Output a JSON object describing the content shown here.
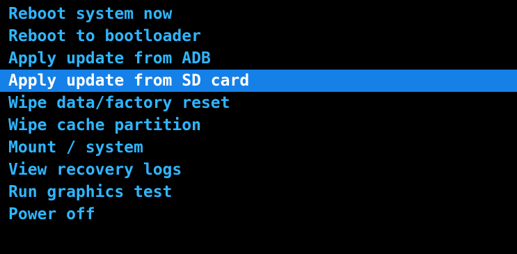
{
  "recovery_menu": {
    "selected_index": 3,
    "colors": {
      "background": "#000000",
      "item_text": "#2fb6ff",
      "selected_background": "#1580e8",
      "selected_text": "#ffffff"
    },
    "items": [
      {
        "label": "Reboot system now"
      },
      {
        "label": "Reboot to bootloader"
      },
      {
        "label": "Apply update from ADB"
      },
      {
        "label": "Apply update from SD card"
      },
      {
        "label": "Wipe data/factory reset"
      },
      {
        "label": "Wipe cache partition"
      },
      {
        "label": "Mount / system"
      },
      {
        "label": "View recovery logs"
      },
      {
        "label": "Run graphics test"
      },
      {
        "label": "Power off"
      }
    ]
  }
}
